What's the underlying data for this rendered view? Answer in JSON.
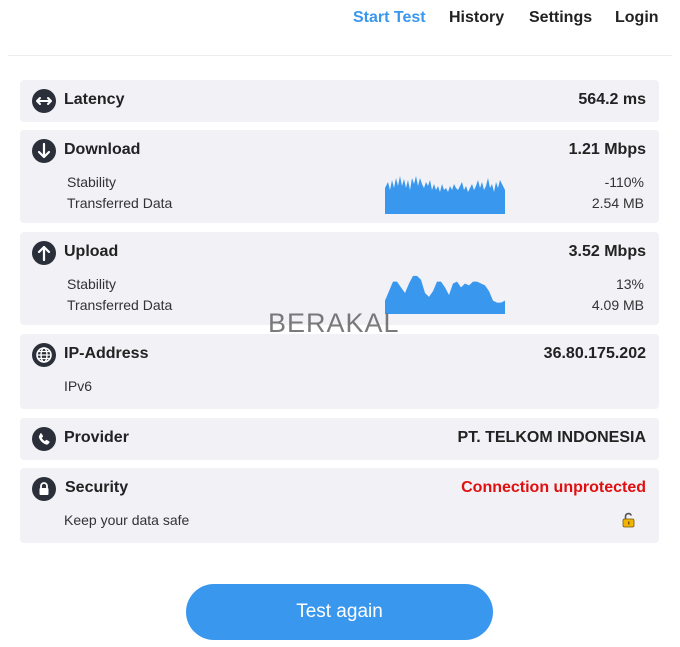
{
  "nav": {
    "items": [
      {
        "label": "Start Test",
        "active": true
      },
      {
        "label": "History",
        "active": false
      },
      {
        "label": "Settings",
        "active": false
      },
      {
        "label": "Login",
        "active": false
      }
    ]
  },
  "latency": {
    "title": "Latency",
    "value": "564.2 ms",
    "icon": "arrows-horizontal-icon"
  },
  "download": {
    "title": "Download",
    "value": "1.21 Mbps",
    "icon": "arrow-down-icon",
    "stability_label": "Stability",
    "stability_value": "-110%",
    "transferred_label": "Transferred Data",
    "transferred_value": "2.54 MB"
  },
  "upload": {
    "title": "Upload",
    "value": "3.52 Mbps",
    "icon": "arrow-up-icon",
    "stability_label": "Stability",
    "stability_value": "13%",
    "transferred_label": "Transferred Data",
    "transferred_value": "4.09 MB"
  },
  "ip": {
    "title": "IP-Address",
    "value": "36.80.175.202",
    "version": "IPv6",
    "icon": "globe-icon"
  },
  "provider": {
    "title": "Provider",
    "value": "PT. TELKOM INDONESIA",
    "icon": "phone-icon"
  },
  "security": {
    "title": "Security",
    "value": "Connection unprotected",
    "note": "Keep your data safe",
    "icon": "lock-icon",
    "status_color": "#e01010"
  },
  "watermark": "BERAKAL",
  "cta": {
    "label": "Test again"
  },
  "colors": {
    "accent": "#3a97ee",
    "card_bg": "#f1f1f6",
    "icon_bg": "#2a2f3a"
  }
}
